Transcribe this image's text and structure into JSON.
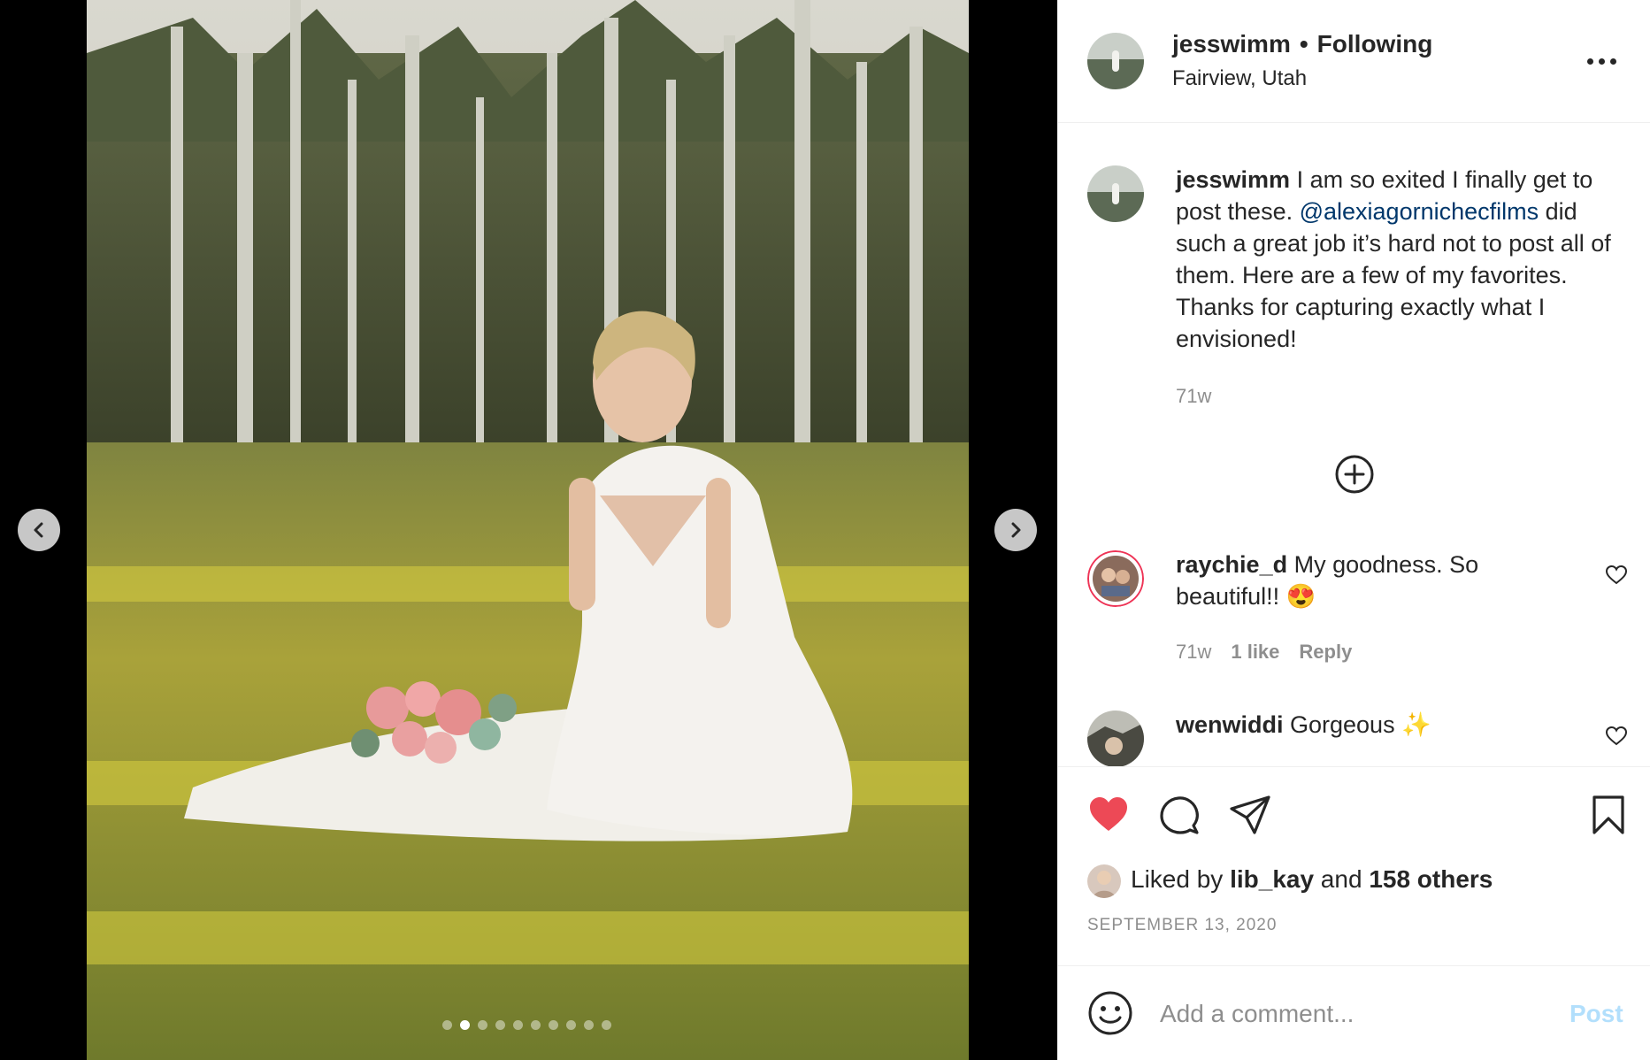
{
  "post": {
    "username": "jesswimm",
    "separator": "•",
    "follow_status": "Following",
    "location": "Fairview, Utah"
  },
  "caption": {
    "username": "jesswimm",
    "text_before": " I am so exited I finally get to post these. ",
    "mention": "@alexiagornichecfilms",
    "text_after": " did such a great job it’s hard not to post all of them. Here are a few of my favorites. Thanks for capturing exactly what I envisioned!",
    "time": "71w"
  },
  "comments": [
    {
      "username": "raychie_d",
      "text": " My goodness. So beautiful!! 😍",
      "time": "71w",
      "likes": "1 like",
      "reply": "Reply"
    },
    {
      "username": "wenwiddi",
      "text": " Gorgeous ✨"
    }
  ],
  "likes": {
    "prefix": "Liked by ",
    "user": "lib_kay",
    "middle": " and ",
    "others": "158 others"
  },
  "date": "SEPTEMBER 13, 2020",
  "add_comment": {
    "placeholder": "Add a comment...",
    "post_label": "Post"
  },
  "carousel": {
    "total": 10,
    "active": 2
  },
  "colors": {
    "like_red": "#ed4956",
    "mention_blue": "#00376b",
    "post_button": "#b2dffc",
    "muted": "#8e8e8e"
  },
  "icons": [
    "chevron-left-icon",
    "chevron-right-icon",
    "more-icon",
    "plus-circle-icon",
    "heart-icon",
    "comment-icon",
    "share-icon",
    "bookmark-icon",
    "emoji-icon"
  ]
}
